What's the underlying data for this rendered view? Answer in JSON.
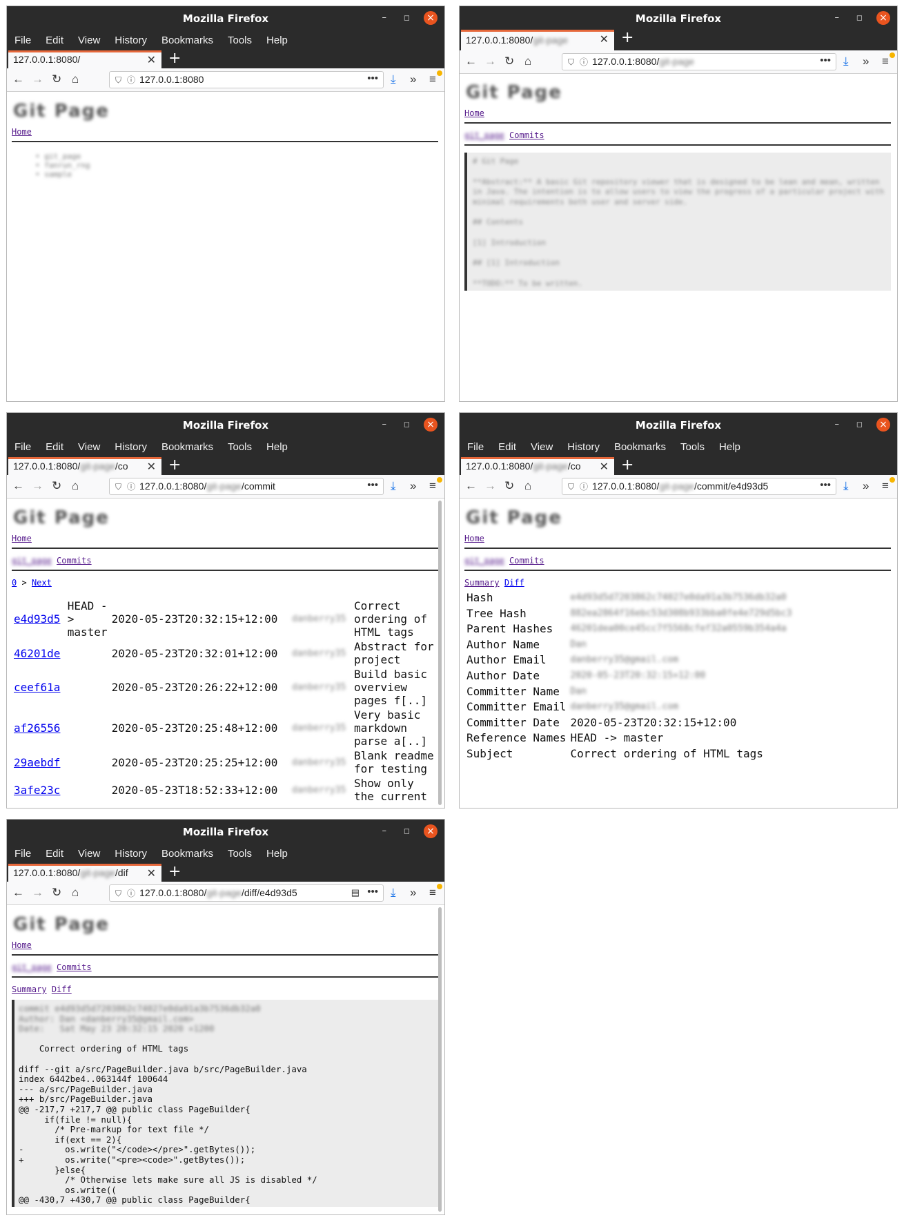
{
  "window_title": "Mozilla Firefox",
  "menu": [
    "File",
    "Edit",
    "View",
    "History",
    "Bookmarks",
    "Tools",
    "Help"
  ],
  "blurred": {
    "logo": "Git Page",
    "repo_name": "git_page",
    "author": "danberry",
    "email": "danberry35@gmail.com"
  },
  "nav": {
    "home": "Home",
    "commits": "Commits",
    "summary": "Summary",
    "diff": "Diff",
    "page_zero": "0",
    "next": "Next",
    "sep": ">"
  },
  "windows": {
    "w1": {
      "tab": "127.0.0.1:8080/",
      "url_host": "127.0.0.1:8080",
      "url_path": "",
      "repos": [
        "git_page",
        "fanrun_rng",
        "sample"
      ]
    },
    "w2": {
      "tab": "127.0.0.1:8080/git-page",
      "url_host": "127.0.0.1:8080/",
      "url_path": "git-page",
      "readme": [
        "# Git Page",
        "**Abstract:** A basic Git repository viewer that is designed to be lean and mean, written in Java. The intention is to allow users to view the progress of a particular project with minimal requirements both user and server side.",
        "## Contents",
        "[1] Introduction",
        "## [1] Introduction",
        "**TODO:** To be written."
      ]
    },
    "w3": {
      "tab": "127.0.0.1:8080/git-page/commit",
      "url_host": "127.0.0.1:8080/",
      "url_blur": "git-page",
      "url_path": "/commit"
    },
    "w4": {
      "tab": "127.0.0.1:8080/git-page/commit/e4d93d5",
      "url_host": "127.0.0.1:8080/",
      "url_blur": "git-page",
      "url_path": "/commit/e4d93d5"
    },
    "w5": {
      "tab": "127.0.0.1:8080/git-page/diff/e4d93d5",
      "url_host": "127.0.0.1:8080/",
      "url_blur": "git-page",
      "url_path": "/diff/e4d93d5"
    }
  },
  "commits": [
    {
      "hash": "e4d93d5",
      "ref": "HEAD -> master",
      "date": "2020-05-23T20:32:15+12:00",
      "author": "danberry35",
      "msg": "Correct ordering of HTML tags"
    },
    {
      "hash": "46201de",
      "ref": "",
      "date": "2020-05-23T20:32:01+12:00",
      "author": "danberry35",
      "msg": "Abstract for project"
    },
    {
      "hash": "ceef61a",
      "ref": "",
      "date": "2020-05-23T20:26:22+12:00",
      "author": "danberry35",
      "msg": "Build basic overview pages f[..]"
    },
    {
      "hash": "af26556",
      "ref": "",
      "date": "2020-05-23T20:25:48+12:00",
      "author": "danberry35",
      "msg": "Very basic markdown parse a[..]"
    },
    {
      "hash": "29aebdf",
      "ref": "",
      "date": "2020-05-23T20:25:25+12:00",
      "author": "danberry35",
      "msg": "Blank readme for testing"
    },
    {
      "hash": "3afe23c",
      "ref": "",
      "date": "2020-05-23T18:52:33+12:00",
      "author": "danberry35",
      "msg": "Show only the current"
    }
  ],
  "summary": [
    {
      "k": "Hash",
      "v": "e4d93d5d7203862c74027e0da91a3b7536db32a0",
      "blur": true
    },
    {
      "k": "Tree Hash",
      "v": "882ea2864f16ebc53d308b933bba0fe4e729d5bc3",
      "blur": true
    },
    {
      "k": "Parent Hashes",
      "v": "46201dea00ce45cc7f5568cfef32a0559b354a4a",
      "blur": true
    },
    {
      "k": "Author Name",
      "v": "Dan",
      "blur": true
    },
    {
      "k": "Author Email",
      "v": "danberry35@gmail.com",
      "blur": true
    },
    {
      "k": "Author Date",
      "v": "2020-05-23T20:32:15+12:00",
      "blur": true
    },
    {
      "k": "Committer Name",
      "v": "Dan",
      "blur": true
    },
    {
      "k": "Committer Email",
      "v": "danberry35@gmail.com",
      "blur": true
    },
    {
      "k": "Committer Date",
      "v": "2020-05-23T20:32:15+12:00",
      "blur": false
    },
    {
      "k": "Reference Names",
      "v": "HEAD -> master",
      "blur": false
    },
    {
      "k": "Subject",
      "v": "Correct ordering of HTML tags",
      "blur": false
    }
  ],
  "diff": {
    "header": [
      "commit e4d93d5d7203862c74027e0da91a3b7536db32a0",
      "Author: Dan <danberry35@gmail.com>",
      "Date:   Sat May 23 20:32:15 2020 +1200"
    ],
    "lines": [
      "",
      "    Correct ordering of HTML tags",
      "",
      "diff --git a/src/PageBuilder.java b/src/PageBuilder.java",
      "index 6442be4..063144f 100644",
      "--- a/src/PageBuilder.java",
      "+++ b/src/PageBuilder.java",
      "@@ -217,7 +217,7 @@ public class PageBuilder{",
      "     if(file != null){",
      "       /* Pre-markup for text file */",
      "       if(ext == 2){",
      "-        os.write(\"</code></pre>\".getBytes());",
      "+        os.write(\"<pre><code>\".getBytes());",
      "       }else{",
      "         /* Otherwise lets make sure all JS is disabled */",
      "         os.write((",
      "@@ -430,7 +430,7 @@ public class PageBuilder{"
    ]
  }
}
